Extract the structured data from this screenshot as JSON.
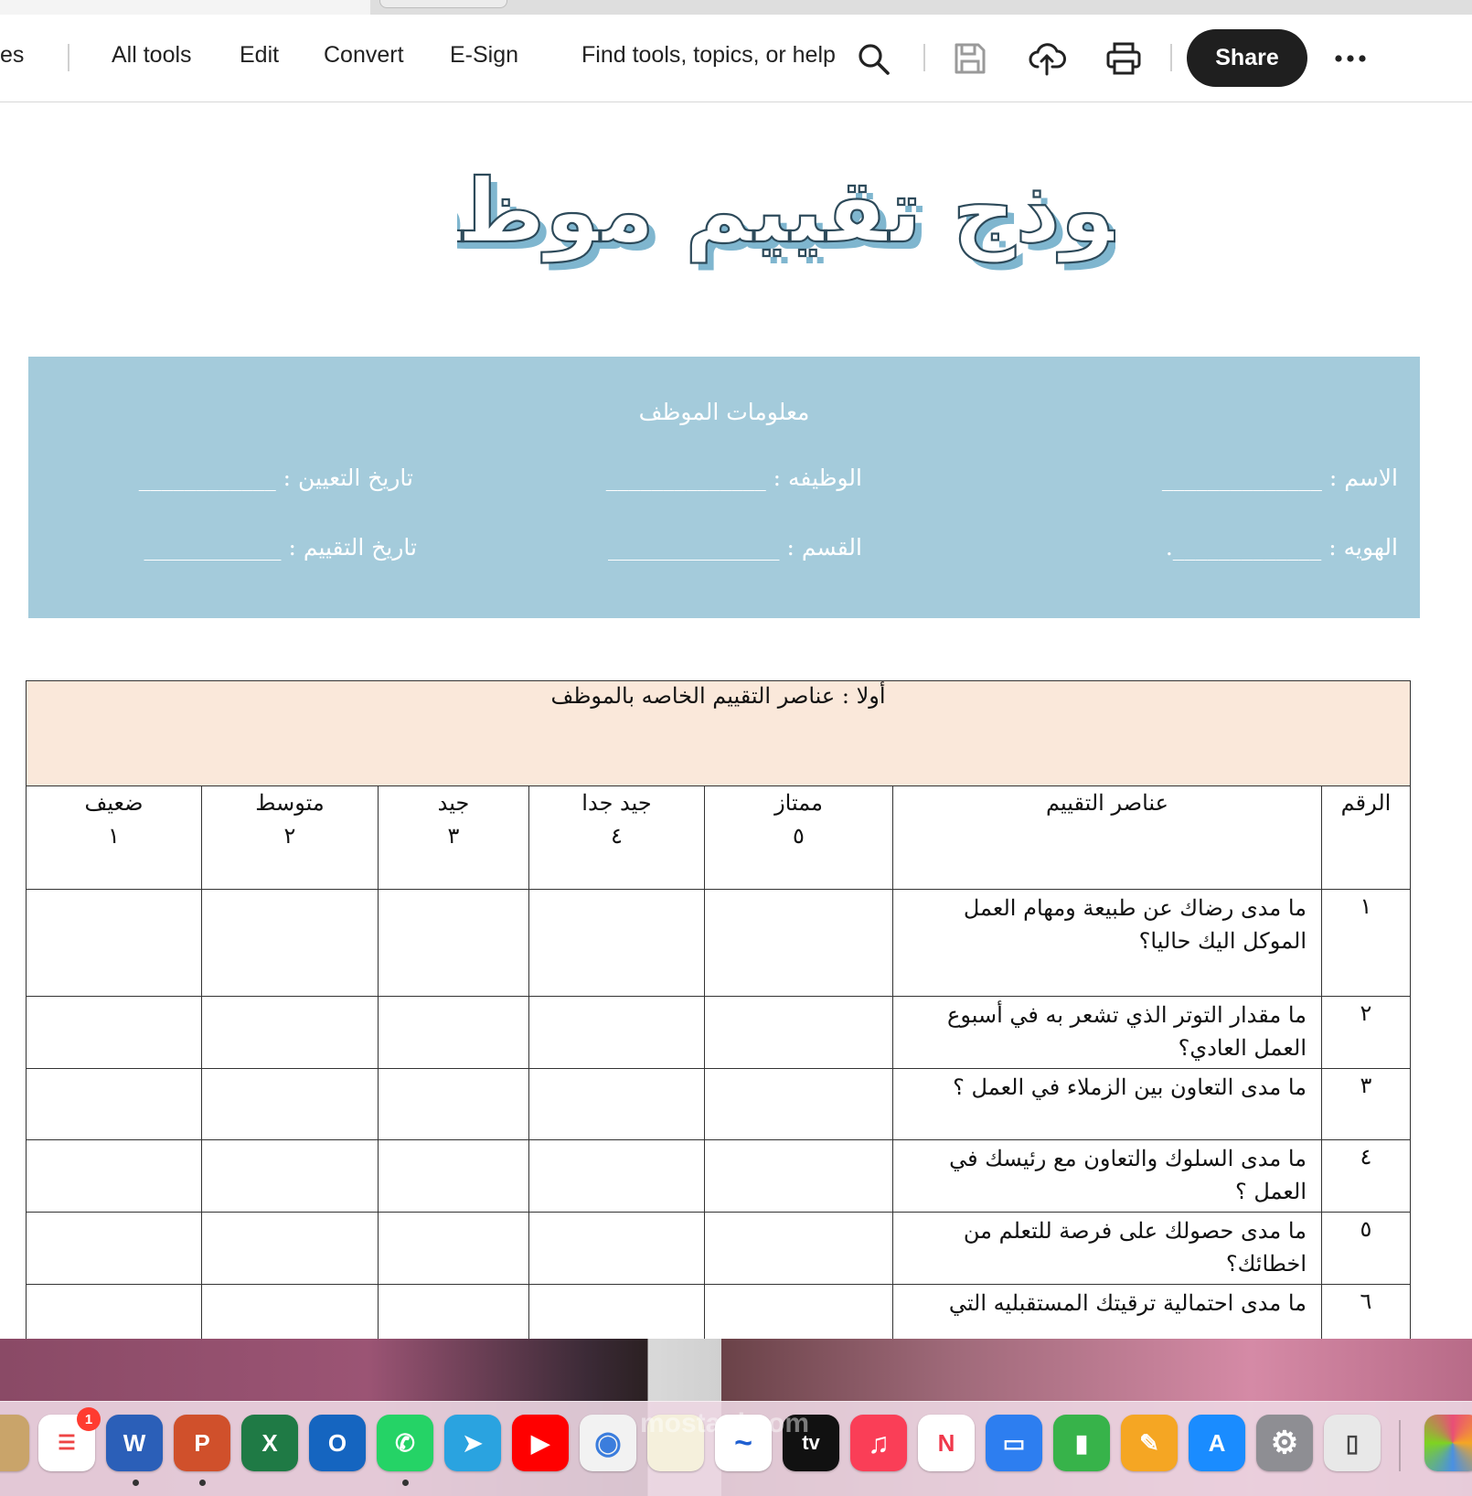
{
  "toolbar": {
    "left_fragment": "es",
    "menu": [
      "All tools",
      "Edit",
      "Convert",
      "E-Sign"
    ],
    "search_label": "Find tools, topics, or help",
    "share_label": "Share"
  },
  "document": {
    "title": "نموذج تقييم موظف",
    "info": {
      "caption": "معلومات الموظف",
      "name": "الاسم : ______________",
      "job": "الوظيفه : ______________",
      "hire_date": "تاريخ التعيين : ____________",
      "id": "الهويه : _____________.",
      "department": "القسم : _______________",
      "eval_date": "تاريخ التقييم : ____________"
    },
    "table": {
      "section_title": "أولا : عناصر التقييم الخاصه بالموظف",
      "col_number": "الرقم",
      "col_items": "عناصر التقييم",
      "ratings": [
        {
          "label": "ممتاز",
          "score": "٥"
        },
        {
          "label": "جيد جدا",
          "score": "٤"
        },
        {
          "label": "جيد",
          "score": "٣"
        },
        {
          "label": "متوسط",
          "score": "٢"
        },
        {
          "label": "ضعيف",
          "score": "١"
        }
      ],
      "rows": [
        {
          "num": "١",
          "text": "ما مدى رضاك عن طبيعة ومهام العمل الموكل اليك حاليا؟"
        },
        {
          "num": "٢",
          "text": "ما مقدار التوتر الذي تشعر به في أسبوع العمل العادي؟"
        },
        {
          "num": "٣",
          "text": "ما مدى التعاون بين الزملاء في العمل ؟"
        },
        {
          "num": "٤",
          "text": "ما مدى السلوك والتعاون مع رئيسك في العمل ؟"
        },
        {
          "num": "٥",
          "text": "ما مدى حصولك على فرصة للتعلم من اخطائك؟"
        },
        {
          "num": "٦",
          "text": "ما مدى احتمالية ترقيتك المستقبليه التي"
        }
      ]
    }
  },
  "dock": {
    "reminders_badge": "1",
    "watermark": "mostaql.com",
    "apps": [
      {
        "name": "Reminders",
        "glyph": "☰",
        "color": "#ffffff"
      },
      {
        "name": "Word",
        "glyph": "W",
        "color": "#2b5fb8"
      },
      {
        "name": "PowerPoint",
        "glyph": "P",
        "color": "#d0502b"
      },
      {
        "name": "Excel",
        "glyph": "X",
        "color": "#1f7a45"
      },
      {
        "name": "Outlook",
        "glyph": "O",
        "color": "#1565c0"
      },
      {
        "name": "WhatsApp",
        "glyph": "✆",
        "color": "#25d366"
      },
      {
        "name": "Telegram",
        "glyph": "➤",
        "color": "#2aa3e0"
      },
      {
        "name": "YouTube",
        "glyph": "▶",
        "color": "#ff0000"
      },
      {
        "name": "Chrome",
        "glyph": "◉",
        "color": "#f2f2f2"
      },
      {
        "name": "Notes",
        "glyph": "",
        "color": "#f5f0dc"
      },
      {
        "name": "Freeform",
        "glyph": "~",
        "color": "#ffffff"
      },
      {
        "name": "Apple TV",
        "glyph": "tv",
        "color": "#111111"
      },
      {
        "name": "Music",
        "glyph": "♫",
        "color": "#fa3e57"
      },
      {
        "name": "News",
        "glyph": "N",
        "color": "#ffffff"
      },
      {
        "name": "Keynote",
        "glyph": "▭",
        "color": "#2d7ef0"
      },
      {
        "name": "Numbers",
        "glyph": "▮",
        "color": "#37b34a"
      },
      {
        "name": "Pages",
        "glyph": "✎",
        "color": "#f5a623"
      },
      {
        "name": "App Store",
        "glyph": "A",
        "color": "#1a8cff"
      },
      {
        "name": "System Settings",
        "glyph": "⚙",
        "color": "#8e8e93"
      },
      {
        "name": "iPhone Mirroring",
        "glyph": "▯",
        "color": "#e8e8e8"
      }
    ]
  }
}
